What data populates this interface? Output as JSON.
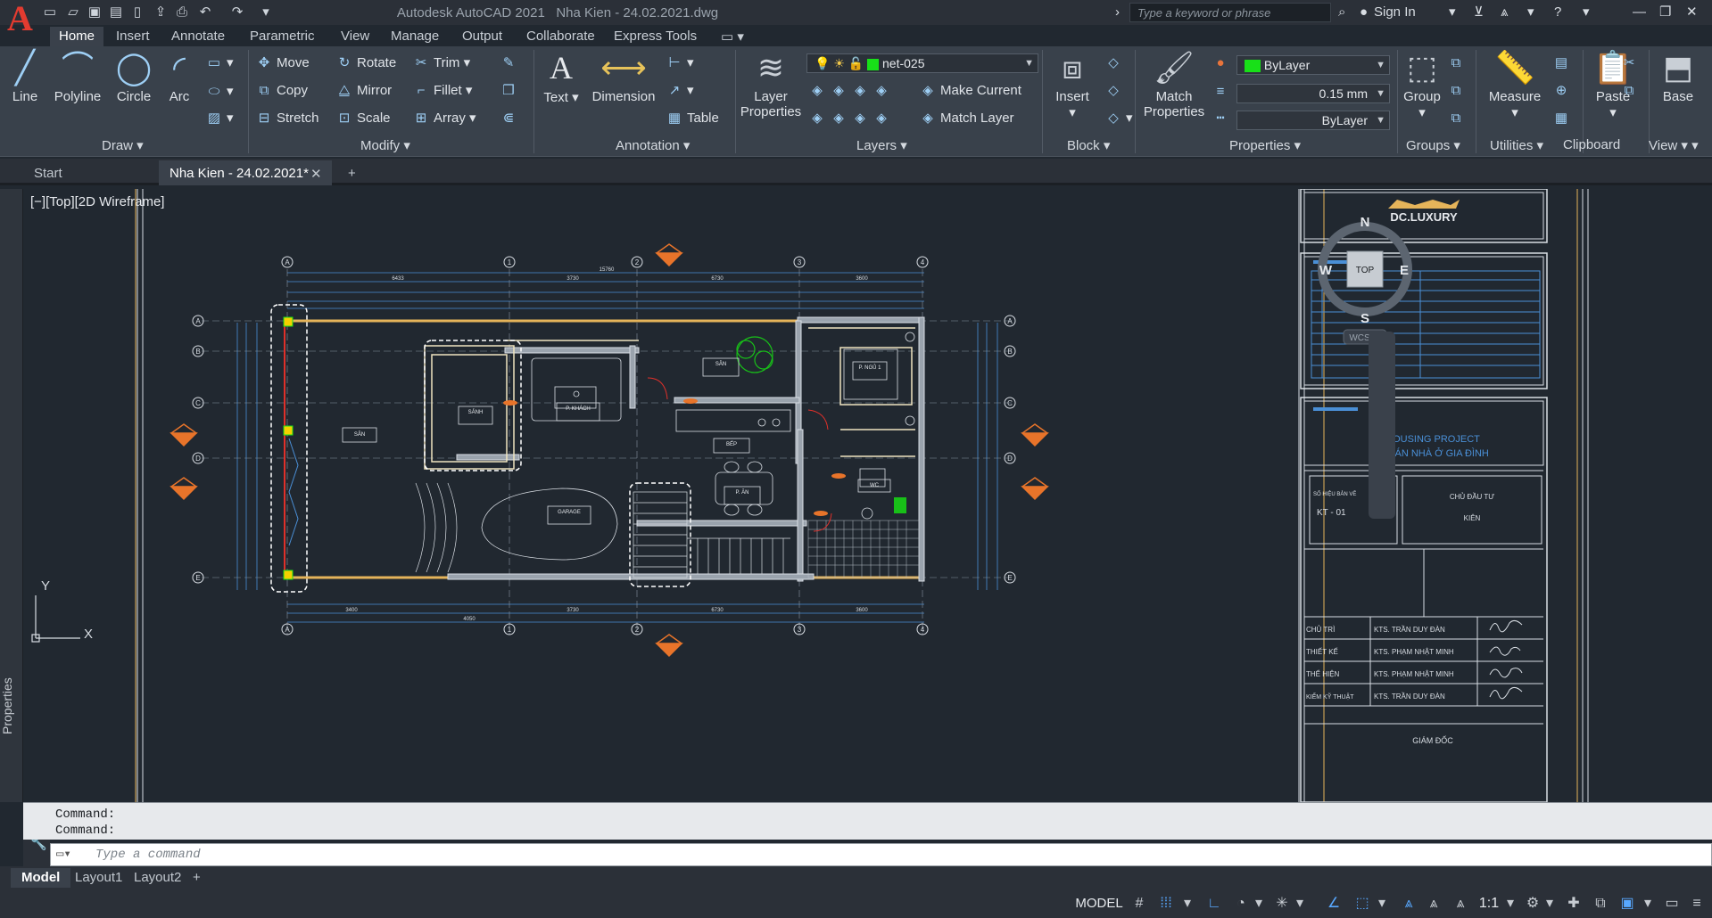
{
  "title_bar": {
    "app_title": "Autodesk AutoCAD 2021",
    "document_title": "Nha Kien - 24.02.2021.dwg",
    "search_placeholder": "Type a keyword or phrase",
    "sign_in": "Sign In"
  },
  "ribbon_tabs": [
    "Home",
    "Insert",
    "Annotate",
    "Parametric",
    "View",
    "Manage",
    "Output",
    "Collaborate",
    "Express Tools"
  ],
  "ribbon": {
    "draw": {
      "title": "Draw",
      "line": "Line",
      "polyline": "Polyline",
      "circle": "Circle",
      "arc": "Arc"
    },
    "modify": {
      "title": "Modify",
      "move": "Move",
      "rotate": "Rotate",
      "trim": "Trim",
      "copy": "Copy",
      "mirror": "Mirror",
      "fillet": "Fillet",
      "stretch": "Stretch",
      "scale": "Scale",
      "array": "Array"
    },
    "annotation": {
      "title": "Annotation",
      "text": "Text",
      "dimension": "Dimension",
      "table": "Table"
    },
    "layers": {
      "title": "Layers",
      "layer_properties_1": "Layer",
      "layer_properties_2": "Properties",
      "current_layer": "net-025",
      "make_current": "Make Current",
      "match_layer": "Match Layer"
    },
    "block": {
      "title": "Block",
      "insert": "Insert"
    },
    "properties": {
      "title": "Properties",
      "match_1": "Match",
      "match_2": "Properties",
      "color": "ByLayer",
      "lineweight": "0.15 mm",
      "linetype": "ByLayer"
    },
    "groups": {
      "title": "Groups",
      "group": "Group"
    },
    "utilities": {
      "title": "Utilities",
      "measure": "Measure"
    },
    "clipboard": {
      "title": "Clipboard",
      "paste": "Paste"
    },
    "view": {
      "title": "View",
      "base": "Base"
    }
  },
  "file_tabs": {
    "start": "Start",
    "active": "Nha Kien - 24.02.2021*"
  },
  "left_palette": {
    "label": "Properties"
  },
  "viewport": {
    "label": "[−][Top][2D Wireframe]"
  },
  "viewcube": {
    "north": "N",
    "south": "S",
    "east": "E",
    "west": "W",
    "face": "TOP",
    "wcs": "WCS"
  },
  "ucs": {
    "x": "X",
    "y": "Y"
  },
  "drawing": {
    "brand": "DC.LUXURY",
    "project_en": "HOUSING PROJECT",
    "project_vi": "DỰ ÁN NHÀ Ở GIA ĐÌNH",
    "sheet_label": "SỐ HIỆU BẢN VẼ",
    "sheet_no": "KT - 01",
    "owner_label": "CHỦ ĐẦU TƯ",
    "owner_name": "KIÊN",
    "signers": [
      {
        "role": "CHỦ TRÌ",
        "name": "KTS. TRẦN DUY ĐÀN"
      },
      {
        "role": "THIẾT KẾ",
        "name": "KTS. PHẠM NHẬT MINH"
      },
      {
        "role": "THỂ HIỆN",
        "name": "KTS. PHẠM NHẬT MINH"
      },
      {
        "role": "KIỂM KỸ THUẬT",
        "name": "KTS. TRẦN DUY ĐÀN"
      }
    ],
    "director": "GIÁM ĐỐC",
    "grid_letters": [
      "A",
      "B",
      "C",
      "D",
      "E"
    ],
    "grid_numbers": [
      "1",
      "2",
      "3",
      "4"
    ],
    "room_labels": [
      "SÂN",
      "SẢNH",
      "P. KHÁCH",
      "GARAGE",
      "BẾP",
      "P. ĂN",
      "P. NGỦ 1",
      "WC"
    ],
    "dimensions": {
      "overall": "15760",
      "top_segments": [
        "6433",
        "3730",
        "6730",
        "3600"
      ],
      "bottom_segments": [
        "3400",
        "4050",
        "3730",
        "6730",
        "3600"
      ]
    }
  },
  "command": {
    "history": [
      "Command:",
      "Command:"
    ],
    "placeholder": "Type a command"
  },
  "layout_tabs": [
    "Model",
    "Layout1",
    "Layout2"
  ],
  "status": {
    "model": "MODEL",
    "scale": "1:1"
  }
}
